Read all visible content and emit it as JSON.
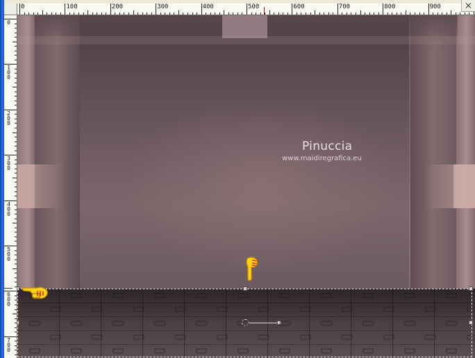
{
  "ruler": {
    "horizontal_labels": [
      "0",
      "100",
      "200",
      "300",
      "400",
      "500",
      "600",
      "700",
      "800",
      "900"
    ],
    "vertical_labels": [
      "0",
      "100",
      "200",
      "300",
      "400",
      "500",
      "600",
      "700"
    ]
  },
  "canvas": {
    "watermark_title": "Pinuccia",
    "watermark_url": "www.maidiregrafica.eu"
  },
  "icons": [
    "pointing-hand-down-icon",
    "pointing-hand-right-icon",
    "close-icon"
  ],
  "colors": {
    "ruler_bg": "#fbfbf6",
    "frame_blue": "#1b5fd6",
    "canvas_mauve": "#7e6a6e",
    "selection_marquee": "#e8e8e8"
  }
}
